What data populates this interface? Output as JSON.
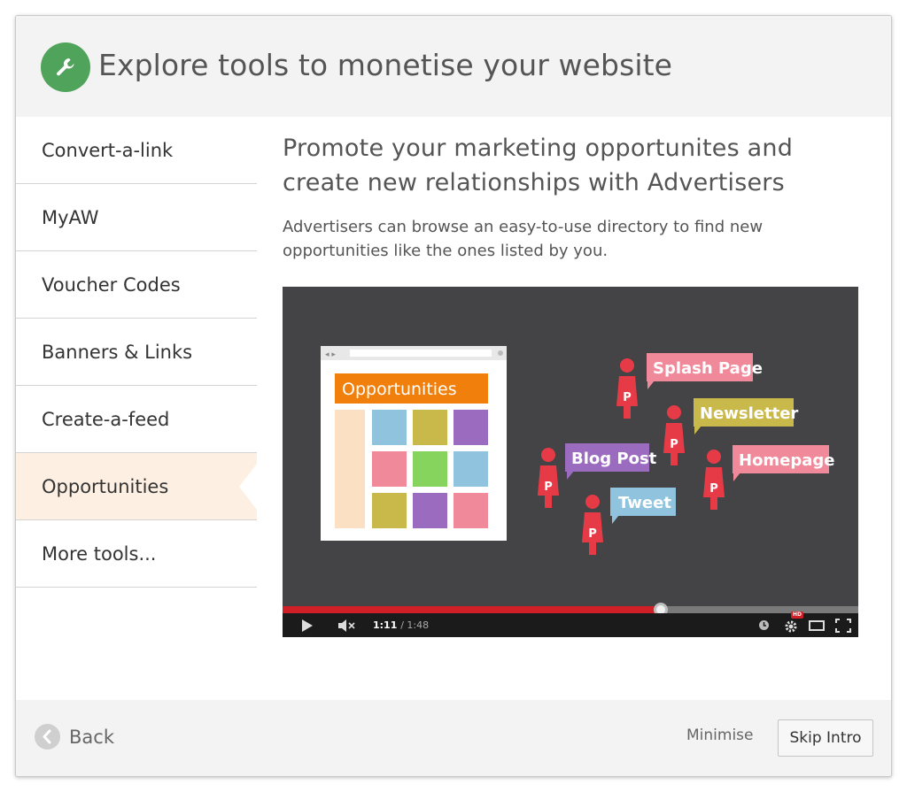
{
  "header": {
    "title": "Explore tools to monetise your website",
    "icon": "wrench-icon",
    "icon_bg_color": "#4fa35a"
  },
  "sidebar": {
    "items": [
      {
        "label": "Convert-a-link",
        "active": false
      },
      {
        "label": "MyAW",
        "active": false
      },
      {
        "label": "Voucher Codes",
        "active": false
      },
      {
        "label": "Banners & Links",
        "active": false
      },
      {
        "label": "Create-a-feed",
        "active": false
      },
      {
        "label": "Opportunities",
        "active": true
      },
      {
        "label": "More tools...",
        "active": false
      }
    ],
    "active_bg_color": "#fdf0e3"
  },
  "main": {
    "heading_line1": "Promote your marketing opportunites and",
    "heading_line2": "create new relationships with Advertisers",
    "description_line1": "Advertisers can browse an easy-to-use directory to find new",
    "description_line2": "opportunities like the ones listed by you."
  },
  "video": {
    "card_title": "Opportunities",
    "bubbles": [
      {
        "label": "Splash Page",
        "color": "#f08a9a"
      },
      {
        "label": "Newsletter",
        "color": "#c9b94b"
      },
      {
        "label": "Blog Post",
        "color": "#9b6bbf"
      },
      {
        "label": "Homepage",
        "color": "#f08a9a"
      },
      {
        "label": "Tweet",
        "color": "#90c4de"
      }
    ],
    "person_badge": "P",
    "current_time": "1:11",
    "duration": "/ 1:48",
    "progress": 0.657,
    "buffered": 1.0,
    "hd_badge": "HD"
  },
  "footer": {
    "back_label": "Back",
    "minimise_label": "Minimise",
    "skip_label": "Skip Intro"
  }
}
